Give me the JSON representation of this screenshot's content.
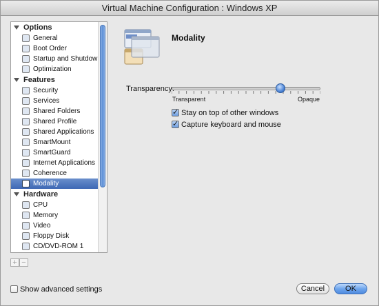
{
  "window": {
    "title": "Virtual Machine Configuration : Windows XP"
  },
  "sidebar": {
    "sections": [
      {
        "label": "Options",
        "items": [
          {
            "label": "General",
            "icon": "monitor-icon"
          },
          {
            "label": "Boot Order",
            "icon": "boot-icon"
          },
          {
            "label": "Startup and Shutdown",
            "icon": "power-icon"
          },
          {
            "label": "Optimization",
            "icon": "optimization-icon"
          }
        ]
      },
      {
        "label": "Features",
        "items": [
          {
            "label": "Security",
            "icon": "shield-icon"
          },
          {
            "label": "Services",
            "icon": "services-icon"
          },
          {
            "label": "Shared Folders",
            "icon": "folder-icon"
          },
          {
            "label": "Shared Profile",
            "icon": "profile-icon"
          },
          {
            "label": "Shared Applications",
            "icon": "applications-icon"
          },
          {
            "label": "SmartMount",
            "icon": "smartmount-icon"
          },
          {
            "label": "SmartGuard",
            "icon": "smartguard-icon"
          },
          {
            "label": "Internet Applications",
            "icon": "internet-icon"
          },
          {
            "label": "Coherence",
            "icon": "coherence-icon"
          },
          {
            "label": "Modality",
            "icon": "modality-icon",
            "selected": true
          }
        ]
      },
      {
        "label": "Hardware",
        "items": [
          {
            "label": "CPU",
            "icon": "cpu-icon"
          },
          {
            "label": "Memory",
            "icon": "memory-icon"
          },
          {
            "label": "Video",
            "icon": "video-icon"
          },
          {
            "label": "Floppy Disk",
            "icon": "floppy-icon"
          },
          {
            "label": "CD/DVD-ROM 1",
            "icon": "cd-icon"
          }
        ]
      }
    ],
    "add_label": "+",
    "remove_label": "−"
  },
  "pane": {
    "title": "Modality",
    "transparency": {
      "label": "Transparency:",
      "min_label": "Transparent",
      "max_label": "Opaque",
      "value": 0.73
    },
    "options": [
      {
        "label": "Stay on top of other windows",
        "checked": true
      },
      {
        "label": "Capture keyboard and mouse",
        "checked": true
      }
    ]
  },
  "footer": {
    "advanced_label": "Show advanced settings",
    "advanced_checked": false,
    "cancel_label": "Cancel",
    "ok_label": "OK"
  },
  "colors": {
    "selection": "#4a72b8",
    "accent": "#5b8fd6"
  }
}
